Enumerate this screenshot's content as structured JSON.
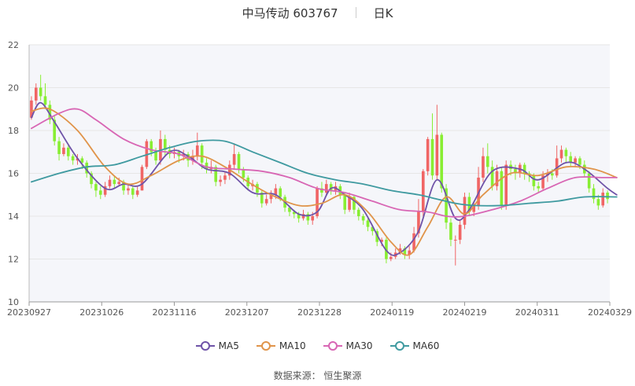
{
  "title": {
    "stock": "中马传动 603767",
    "period": "日K"
  },
  "source": "数据来源： 恒生聚源",
  "colors": {
    "up": "#f06565",
    "down": "#88ee33",
    "ma5": "#6f53a8",
    "ma10": "#e0944a",
    "ma30": "#d866b4",
    "ma60": "#3f9aa0",
    "grid": "#e6e6e6",
    "plot_bg": "#f5f6fa"
  },
  "chart_data": {
    "type": "candlestick",
    "ylim": [
      10,
      22
    ],
    "y_ticks": [
      "10",
      "12",
      "14",
      "16",
      "18",
      "20",
      "22"
    ],
    "x_ticks": [
      "20230927",
      "20231026",
      "20231116",
      "20231207",
      "20231228",
      "20240119",
      "20240219",
      "20240311",
      "20240329"
    ],
    "candles": [
      [
        18.6,
        19.4,
        18.5,
        19.6
      ],
      [
        19.4,
        20.0,
        19.2,
        20.2
      ],
      [
        20.0,
        19.6,
        19.4,
        20.6
      ],
      [
        19.6,
        19.2,
        19.0,
        20.2
      ],
      [
        19.2,
        18.5,
        18.3,
        19.4
      ],
      [
        18.5,
        17.5,
        17.3,
        18.7
      ],
      [
        17.5,
        16.9,
        16.6,
        17.7
      ],
      [
        16.9,
        17.2,
        16.8,
        17.4
      ],
      [
        17.2,
        16.8,
        16.6,
        17.3
      ],
      [
        16.8,
        16.6,
        16.4,
        16.9
      ],
      [
        16.6,
        16.7,
        16.4,
        16.9
      ],
      [
        16.7,
        16.5,
        16.2,
        16.8
      ],
      [
        16.5,
        16.0,
        15.8,
        16.6
      ],
      [
        16.0,
        15.5,
        15.3,
        16.1
      ],
      [
        15.5,
        15.2,
        14.9,
        15.6
      ],
      [
        15.2,
        15.0,
        14.8,
        15.4
      ],
      [
        15.0,
        15.4,
        14.9,
        15.6
      ],
      [
        15.4,
        15.7,
        15.3,
        15.9
      ],
      [
        15.7,
        15.5,
        15.3,
        15.9
      ],
      [
        15.5,
        15.6,
        15.4,
        15.8
      ],
      [
        15.6,
        15.2,
        15.0,
        15.7
      ],
      [
        15.2,
        15.3,
        15.0,
        15.5
      ],
      [
        15.3,
        15.0,
        14.8,
        15.4
      ],
      [
        15.0,
        15.2,
        14.9,
        15.4
      ],
      [
        15.2,
        16.3,
        15.2,
        16.4
      ],
      [
        16.3,
        17.5,
        16.2,
        17.6
      ],
      [
        17.5,
        17.0,
        16.8,
        17.6
      ],
      [
        17.0,
        16.6,
        16.4,
        17.2
      ],
      [
        16.6,
        17.6,
        16.4,
        18.0
      ],
      [
        17.6,
        17.1,
        16.8,
        17.8
      ],
      [
        17.1,
        16.9,
        16.7,
        17.3
      ],
      [
        16.9,
        17.0,
        16.7,
        17.2
      ],
      [
        17.0,
        16.8,
        16.5,
        17.1
      ],
      [
        16.8,
        16.9,
        16.6,
        17.1
      ],
      [
        16.9,
        16.6,
        16.3,
        17.0
      ],
      [
        16.6,
        16.8,
        16.4,
        17.1
      ],
      [
        16.8,
        17.3,
        16.6,
        17.9
      ],
      [
        17.3,
        16.5,
        16.2,
        17.4
      ],
      [
        16.5,
        16.2,
        16.0,
        16.7
      ],
      [
        16.2,
        16.3,
        16.0,
        16.6
      ],
      [
        16.3,
        15.6,
        15.4,
        16.4
      ],
      [
        15.6,
        15.7,
        15.4,
        15.9
      ],
      [
        15.7,
        15.9,
        15.5,
        16.1
      ],
      [
        15.9,
        16.4,
        15.7,
        16.6
      ],
      [
        16.4,
        16.9,
        16.2,
        17.4
      ],
      [
        16.9,
        16.2,
        16.0,
        17.0
      ],
      [
        16.2,
        15.8,
        15.6,
        16.3
      ],
      [
        15.8,
        15.4,
        15.2,
        15.9
      ],
      [
        15.4,
        15.5,
        15.2,
        15.7
      ],
      [
        15.5,
        15.1,
        14.9,
        15.6
      ],
      [
        15.1,
        14.6,
        14.4,
        15.2
      ],
      [
        14.6,
        14.8,
        14.5,
        15.0
      ],
      [
        14.8,
        15.0,
        14.6,
        15.2
      ],
      [
        15.0,
        15.3,
        14.8,
        15.5
      ],
      [
        15.3,
        14.9,
        14.7,
        15.4
      ],
      [
        14.9,
        14.4,
        14.2,
        15.0
      ],
      [
        14.4,
        14.2,
        14.0,
        14.5
      ],
      [
        14.2,
        14.1,
        13.9,
        14.3
      ],
      [
        14.1,
        13.9,
        13.7,
        14.2
      ],
      [
        13.9,
        14.1,
        13.8,
        14.3
      ],
      [
        14.1,
        13.8,
        13.6,
        14.2
      ],
      [
        13.8,
        14.0,
        13.6,
        14.2
      ],
      [
        14.0,
        15.3,
        13.9,
        15.4
      ],
      [
        15.3,
        15.1,
        14.9,
        15.6
      ],
      [
        15.1,
        15.5,
        15.0,
        15.7
      ],
      [
        15.5,
        15.2,
        15.0,
        15.6
      ],
      [
        15.2,
        15.4,
        15.0,
        15.6
      ],
      [
        15.4,
        15.0,
        14.8,
        15.5
      ],
      [
        15.0,
        14.3,
        14.1,
        15.1
      ],
      [
        14.3,
        14.9,
        14.2,
        15.1
      ],
      [
        14.9,
        14.3,
        14.1,
        15.0
      ],
      [
        14.3,
        14.0,
        13.8,
        14.4
      ],
      [
        14.0,
        13.8,
        13.6,
        14.1
      ],
      [
        13.8,
        13.5,
        13.3,
        13.9
      ],
      [
        13.5,
        13.3,
        13.1,
        13.6
      ],
      [
        13.3,
        12.8,
        12.6,
        13.4
      ],
      [
        12.8,
        12.9,
        12.6,
        13.0
      ],
      [
        12.9,
        12.0,
        11.8,
        13.0
      ],
      [
        12.0,
        12.1,
        11.9,
        12.3
      ],
      [
        12.1,
        12.3,
        12.0,
        12.5
      ],
      [
        12.3,
        12.5,
        12.2,
        12.7
      ],
      [
        12.5,
        12.2,
        12.0,
        12.6
      ],
      [
        12.2,
        12.4,
        12.0,
        12.6
      ],
      [
        12.4,
        13.2,
        12.3,
        13.5
      ],
      [
        13.2,
        14.2,
        13.0,
        14.8
      ],
      [
        14.2,
        16.1,
        14.0,
        16.2
      ],
      [
        16.1,
        17.6,
        15.9,
        17.7
      ],
      [
        17.6,
        15.9,
        15.7,
        18.8
      ],
      [
        15.9,
        17.8,
        15.7,
        19.2
      ],
      [
        17.8,
        15.3,
        15.1,
        17.9
      ],
      [
        15.3,
        13.7,
        13.4,
        15.5
      ],
      [
        13.7,
        12.9,
        12.6,
        13.9
      ],
      [
        12.9,
        12.9,
        11.7,
        13.1
      ],
      [
        12.9,
        13.6,
        12.7,
        13.8
      ],
      [
        13.6,
        14.9,
        13.4,
        15.1
      ],
      [
        14.9,
        14.2,
        14.0,
        15.1
      ],
      [
        14.2,
        14.5,
        14.0,
        14.7
      ],
      [
        14.5,
        15.8,
        14.3,
        16.3
      ],
      [
        15.8,
        16.8,
        15.6,
        17.2
      ],
      [
        16.8,
        16.3,
        16.0,
        17.4
      ],
      [
        16.3,
        15.4,
        15.2,
        16.6
      ],
      [
        15.4,
        16.1,
        15.2,
        16.4
      ],
      [
        16.1,
        14.5,
        14.3,
        16.3
      ],
      [
        14.5,
        16.4,
        14.3,
        16.6
      ],
      [
        16.4,
        16.2,
        15.9,
        16.6
      ],
      [
        16.2,
        16.0,
        15.7,
        16.4
      ],
      [
        16.0,
        16.4,
        15.8,
        16.5
      ],
      [
        16.4,
        16.0,
        15.7,
        16.5
      ],
      [
        16.0,
        15.9,
        15.6,
        16.1
      ],
      [
        15.9,
        15.4,
        15.2,
        16.0
      ],
      [
        15.4,
        15.3,
        15.1,
        15.6
      ],
      [
        15.3,
        15.9,
        15.2,
        16.1
      ],
      [
        15.9,
        16.0,
        15.6,
        16.2
      ],
      [
        16.0,
        15.9,
        15.7,
        16.2
      ],
      [
        15.9,
        16.7,
        15.8,
        17.3
      ],
      [
        16.7,
        17.1,
        16.5,
        17.3
      ],
      [
        17.1,
        16.8,
        16.5,
        17.2
      ],
      [
        16.8,
        16.5,
        16.3,
        17.0
      ],
      [
        16.5,
        16.7,
        16.3,
        16.8
      ],
      [
        16.7,
        16.4,
        16.2,
        16.8
      ],
      [
        16.4,
        16.0,
        15.8,
        16.6
      ],
      [
        16.0,
        15.3,
        15.1,
        16.1
      ],
      [
        15.3,
        14.8,
        14.6,
        15.5
      ],
      [
        14.8,
        14.5,
        14.3,
        15.0
      ],
      [
        14.5,
        15.1,
        14.4,
        15.3
      ],
      [
        15.1,
        14.8,
        14.6,
        15.2
      ]
    ],
    "series": [
      {
        "name": "MA5",
        "anchors": [
          [
            0,
            18.6
          ],
          [
            2,
            19.3
          ],
          [
            5,
            18.4
          ],
          [
            10,
            16.7
          ],
          [
            16,
            15.3
          ],
          [
            20,
            15.5
          ],
          [
            24,
            15.5
          ],
          [
            30,
            17.0
          ],
          [
            34,
            16.8
          ],
          [
            38,
            16.2
          ],
          [
            43,
            16.0
          ],
          [
            48,
            15.1
          ],
          [
            53,
            15.0
          ],
          [
            58,
            14.1
          ],
          [
            62,
            14.2
          ],
          [
            65,
            15.3
          ],
          [
            68,
            15.0
          ],
          [
            72,
            14.3
          ],
          [
            77,
            12.4
          ],
          [
            80,
            12.3
          ],
          [
            84,
            13.3
          ],
          [
            88,
            15.7
          ],
          [
            92,
            13.9
          ],
          [
            95,
            14.3
          ],
          [
            100,
            16.1
          ],
          [
            106,
            16.2
          ],
          [
            110,
            15.7
          ],
          [
            116,
            16.5
          ],
          [
            120,
            16.2
          ],
          [
            125,
            15.3
          ],
          [
            127,
            15.0
          ]
        ]
      },
      {
        "name": "MA10",
        "anchors": [
          [
            0,
            18.9
          ],
          [
            4,
            19.0
          ],
          [
            10,
            18.0
          ],
          [
            16,
            16.3
          ],
          [
            21,
            15.5
          ],
          [
            26,
            15.9
          ],
          [
            32,
            16.6
          ],
          [
            37,
            16.8
          ],
          [
            42,
            16.3
          ],
          [
            47,
            15.6
          ],
          [
            52,
            15.0
          ],
          [
            58,
            14.5
          ],
          [
            63,
            14.6
          ],
          [
            68,
            15.0
          ],
          [
            73,
            14.2
          ],
          [
            78,
            12.8
          ],
          [
            82,
            12.2
          ],
          [
            86,
            13.5
          ],
          [
            90,
            14.9
          ],
          [
            94,
            14.1
          ],
          [
            98,
            15.0
          ],
          [
            104,
            16.0
          ],
          [
            110,
            15.9
          ],
          [
            116,
            16.3
          ],
          [
            122,
            16.2
          ],
          [
            127,
            15.8
          ]
        ]
      },
      {
        "name": "MA30",
        "anchors": [
          [
            0,
            18.1
          ],
          [
            6,
            18.8
          ],
          [
            10,
            19.0
          ],
          [
            14,
            18.5
          ],
          [
            20,
            17.6
          ],
          [
            26,
            17.1
          ],
          [
            32,
            16.9
          ],
          [
            38,
            16.3
          ],
          [
            44,
            16.2
          ],
          [
            50,
            16.1
          ],
          [
            56,
            15.8
          ],
          [
            62,
            15.3
          ],
          [
            68,
            15.1
          ],
          [
            74,
            14.7
          ],
          [
            80,
            14.3
          ],
          [
            86,
            14.2
          ],
          [
            90,
            14.0
          ],
          [
            94,
            14.0
          ],
          [
            100,
            14.3
          ],
          [
            106,
            14.7
          ],
          [
            112,
            15.3
          ],
          [
            118,
            15.8
          ],
          [
            124,
            15.8
          ],
          [
            127,
            15.8
          ]
        ]
      },
      {
        "name": "MA60",
        "anchors": [
          [
            0,
            15.6
          ],
          [
            6,
            16.0
          ],
          [
            12,
            16.3
          ],
          [
            18,
            16.4
          ],
          [
            24,
            16.8
          ],
          [
            30,
            17.2
          ],
          [
            36,
            17.5
          ],
          [
            42,
            17.5
          ],
          [
            48,
            17.0
          ],
          [
            54,
            16.5
          ],
          [
            60,
            16.0
          ],
          [
            66,
            15.7
          ],
          [
            72,
            15.5
          ],
          [
            78,
            15.2
          ],
          [
            84,
            15.0
          ],
          [
            88,
            14.8
          ],
          [
            92,
            14.6
          ],
          [
            96,
            14.5
          ],
          [
            102,
            14.5
          ],
          [
            108,
            14.6
          ],
          [
            114,
            14.7
          ],
          [
            120,
            14.9
          ],
          [
            127,
            14.9
          ]
        ]
      }
    ],
    "grid": true,
    "legend_position": "bottom"
  }
}
